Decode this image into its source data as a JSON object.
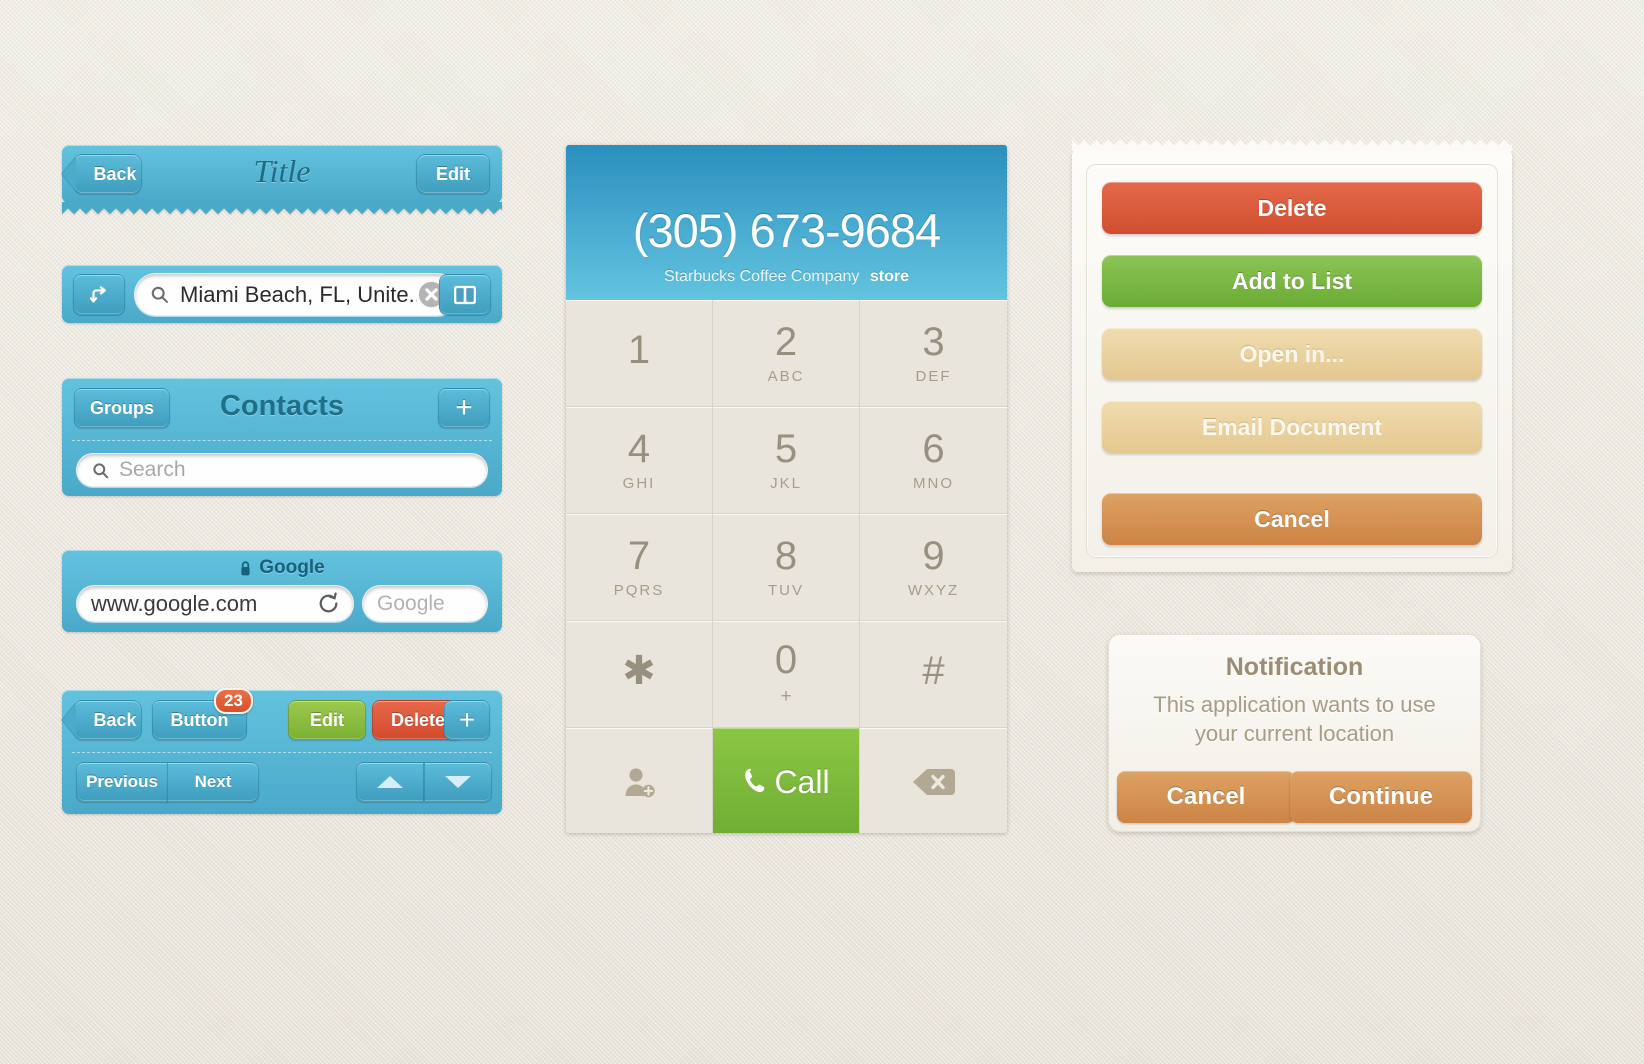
{
  "navbar_title": {
    "back_label": "Back",
    "title": "Title",
    "edit_label": "Edit"
  },
  "search_bar": {
    "directions_icon": "directions-arrow-icon",
    "search_icon": "search-icon",
    "value": "Miami Beach, FL, Unite...",
    "clear_icon": "clear-circle-icon",
    "bookmarks_icon": "book-icon"
  },
  "contacts_bar": {
    "groups_label": "Groups",
    "title": "Contacts",
    "add_label": "+",
    "search_placeholder": "Search",
    "search_icon": "search-icon"
  },
  "browser_bar": {
    "lock_icon": "lock-icon",
    "site_title": "Google",
    "url_value": "www.google.com",
    "reload_icon": "reload-icon",
    "search_placeholder": "Google"
  },
  "toolbar": {
    "back_label": "Back",
    "button_label": "Button",
    "badge_count": "23",
    "edit_label": "Edit",
    "delete_label": "Delete",
    "add_label": "+",
    "previous_label": "Previous",
    "next_label": "Next",
    "up_icon": "triangle-up-icon",
    "down_icon": "triangle-down-icon"
  },
  "dialer": {
    "number": "(305) 673-9684",
    "caller_name": "Starbucks Coffee Company",
    "caller_type": "store",
    "keys": [
      {
        "digit": "1",
        "letters": ""
      },
      {
        "digit": "2",
        "letters": "ABC"
      },
      {
        "digit": "3",
        "letters": "DEF"
      },
      {
        "digit": "4",
        "letters": "GHI"
      },
      {
        "digit": "5",
        "letters": "JKL"
      },
      {
        "digit": "6",
        "letters": "MNO"
      },
      {
        "digit": "7",
        "letters": "PQRS"
      },
      {
        "digit": "8",
        "letters": "TUV"
      },
      {
        "digit": "9",
        "letters": "WXYZ"
      },
      {
        "digit": "✱",
        "letters": ""
      },
      {
        "digit": "0",
        "letters": "+"
      },
      {
        "digit": "#",
        "letters": ""
      }
    ],
    "add_contact_icon": "add-contact-icon",
    "call_label": "Call",
    "call_icon": "phone-icon",
    "backspace_icon": "backspace-icon"
  },
  "action_sheet": {
    "buttons": [
      {
        "label": "Delete",
        "style": "red"
      },
      {
        "label": "Add to List",
        "style": "green"
      },
      {
        "label": "Open in...",
        "style": "tan"
      },
      {
        "label": "Email Document",
        "style": "tan"
      },
      {
        "label": "Cancel",
        "style": "orange"
      }
    ]
  },
  "notification": {
    "title": "Notification",
    "message": "This application wants to use your current location",
    "cancel_label": "Cancel",
    "continue_label": "Continue"
  },
  "colors": {
    "blue": "#4aa9c9",
    "green": "#7cb83f",
    "red": "#d9533a",
    "orange": "#cf8547",
    "tan": "#e8cd96",
    "background": "#e9e5dc"
  }
}
